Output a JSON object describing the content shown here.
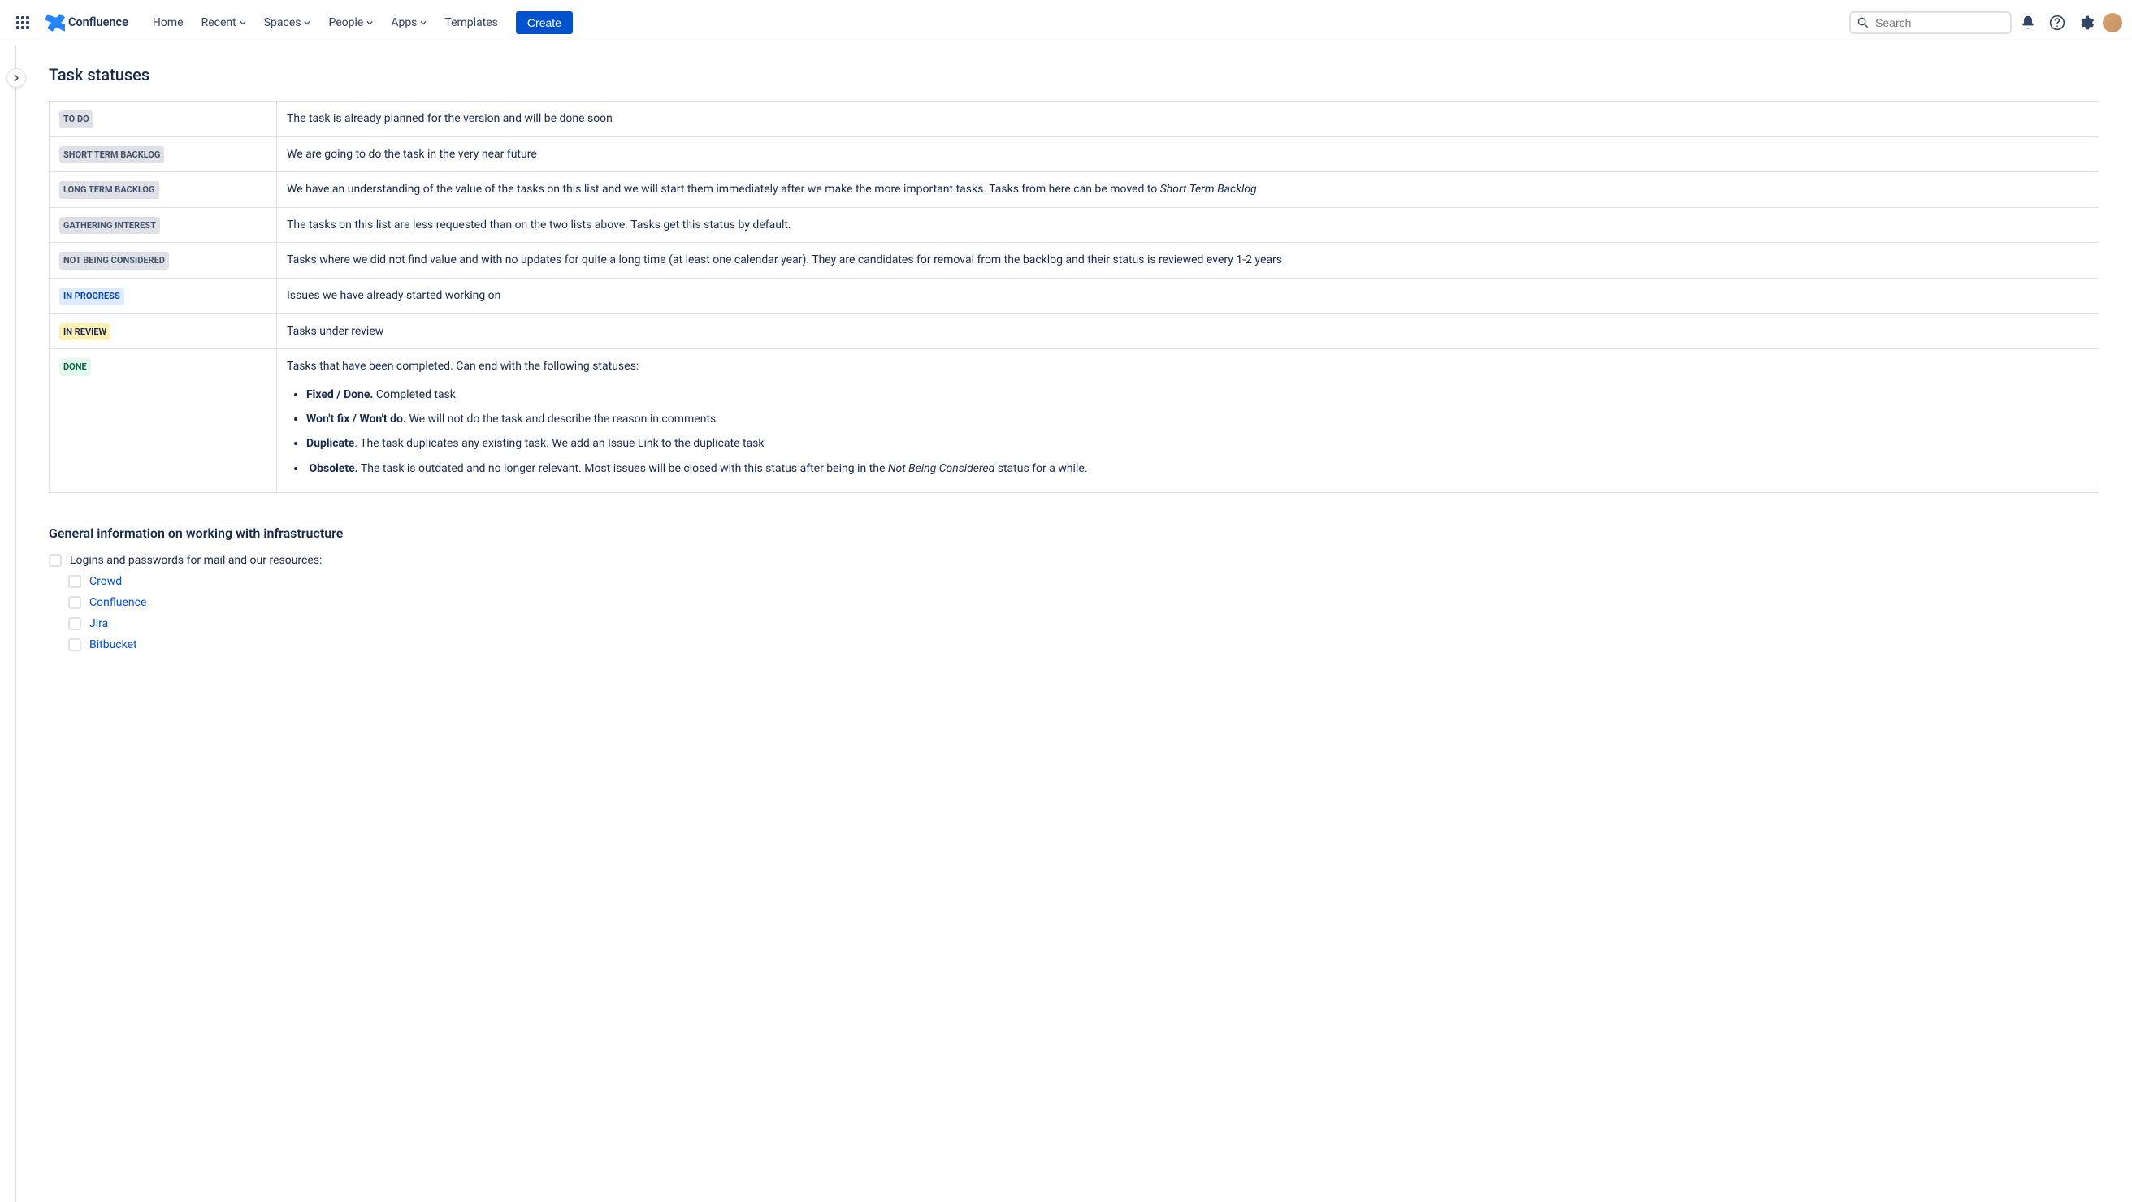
{
  "nav": {
    "product_name": "Confluence",
    "items": {
      "home": "Home",
      "recent": "Recent",
      "spaces": "Spaces",
      "people": "People",
      "apps": "Apps",
      "templates": "Templates"
    },
    "create_label": "Create",
    "search_placeholder": "Search"
  },
  "page": {
    "title": "Task statuses",
    "section2_heading": "General information on working with infrastructure"
  },
  "statuses": {
    "todo": {
      "label": "TO DO",
      "desc": "The task is already planned for the version and will be done soon"
    },
    "short_term": {
      "label": "SHORT TERM BACKLOG",
      "desc": "We are going to do the task in the very near future"
    },
    "long_term": {
      "label": "LONG TERM BACKLOG",
      "desc_pre": "We have an understanding of the value of the tasks on this list and we will start them immediately after we make the more important tasks. Tasks from here can be moved to ",
      "desc_italic": "Short Term Backlog"
    },
    "gathering": {
      "label": "GATHERING INTEREST",
      "desc": "The tasks on this list are less requested than on the two lists above. Tasks get this status by default."
    },
    "not_considered": {
      "label": "NOT BEING CONSIDERED",
      "desc": "Tasks where we did not find value and with no updates for quite a long time (at least one calendar year). They are candidates for removal from the backlog and their status is reviewed every 1-2 years"
    },
    "in_progress": {
      "label": "IN PROGRESS",
      "desc": "Issues we have already started working on"
    },
    "in_review": {
      "label": "IN REVIEW",
      "desc": "Tasks under review"
    },
    "done": {
      "label": "DONE",
      "desc": "Tasks that have been completed. Can end with the following statuses:",
      "bullets": {
        "fixed_bold": "Fixed / Done.",
        "fixed_rest": "  Completed task",
        "wontfix_bold": "Won't fix / Won't do.",
        "wontfix_rest": " We will not do the task and describe the reason in comments",
        "duplicate_bold": "Duplicate",
        "duplicate_rest": ". The task duplicates any existing task. We add an Issue Link to the duplicate task",
        "obsolete_bold": "Obsolete.",
        "obsolete_pre": " The task is outdated and no longer relevant. Most issues will be closed with this status after being in the ",
        "obsolete_italic": "Not Being Considered",
        "obsolete_post": " status for a while."
      }
    }
  },
  "tasks": {
    "parent": "Logins and passwords for mail and our resources:",
    "children": {
      "crowd": "Crowd",
      "confluence": "Confluence",
      "jira": "Jira",
      "bitbucket": "Bitbucket"
    }
  }
}
